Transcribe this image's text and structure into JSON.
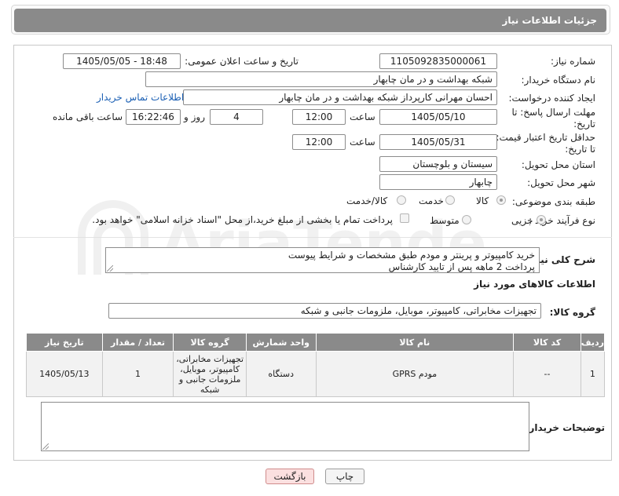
{
  "header": {
    "title": "جزئیات اطلاعات نیاز"
  },
  "form": {
    "need_number": {
      "label": "شماره نیاز:",
      "value": "1105092835000061"
    },
    "announce": {
      "label": "تاریخ و ساعت اعلان عمومی:",
      "value": "1405/05/05 - 18:48"
    },
    "buyer_org": {
      "label": "نام دستگاه خریدار:",
      "value": "شبکه بهداشت و در مان چابهار"
    },
    "requester": {
      "label": "ایجاد کننده درخواست:",
      "value": "احسان مهرانی کارپرداز شبکه بهداشت و در مان چابهار",
      "contact_link": "اطلاعات تماس خریدار"
    },
    "reply_deadline": {
      "label_line1": "مهلت ارسال پاسخ: تا",
      "label_line2": "تاریخ:",
      "date": "1405/05/10",
      "time_label": "ساعت",
      "time": "12:00",
      "days": "4",
      "days_label": "روز و",
      "remaining": "16:22:46",
      "remaining_label": "ساعت باقی مانده"
    },
    "price_validity": {
      "label_line1": "حداقل تاریخ اعتبار قیمت:",
      "label_line2": "تا تاریخ:",
      "date": "1405/05/31",
      "time_label": "ساعت",
      "time": "12:00"
    },
    "delivery_province": {
      "label": "استان محل تحویل:",
      "value": "سیستان و بلوچستان"
    },
    "delivery_city": {
      "label": "شهر محل تحویل:",
      "value": "چابهار"
    },
    "category": {
      "label": "طبقه بندی موضوعی:",
      "options": [
        "کالا",
        "خدمت",
        "کالا/خدمت"
      ],
      "selected": "کالا"
    },
    "purchase_type": {
      "label": "نوع فرآیند خرید :",
      "options": [
        "جزیی",
        "متوسط"
      ],
      "selected": "جزیی",
      "payment_note": "پرداخت تمام یا بخشی از مبلغ خرید،از محل \"اسناد خزانه اسلامی\" خواهد بود."
    },
    "description": {
      "label": "شرح کلی نیاز:",
      "line1": "خرید کامپیوتر و پرینتر و مودم طبق مشخصات و شرایط پیوست",
      "line2": "پرداخت 2 ماهه پس از تایید کارشناس"
    },
    "goods_info_title": "اطلاعات کالاهای مورد نیاز",
    "goods_group": {
      "label": "گروه کالا:",
      "value": "تجهیزات مخابراتی، کامپیوتر، موبایل، ملزومات جانبی و شبکه"
    },
    "buyer_notes": {
      "label": "توضیحات خریدار:",
      "value": ""
    }
  },
  "goods_table": {
    "headers": [
      "ردیف",
      "کد کالا",
      "نام کالا",
      "واحد شمارش",
      "گروه کالا",
      "تعداد / مقدار",
      "تاریخ نیاز"
    ],
    "rows": [
      {
        "row": "1",
        "code": "--",
        "name": "مودم GPRS",
        "unit": "دستگاه",
        "group": "تجهیزات مخابراتی، کامپیوتر، موبایل، ملزومات جانبی و شبکه",
        "qty": "1",
        "date": "1405/05/13"
      }
    ]
  },
  "buttons": {
    "print": "چاپ",
    "back": "بازگشت"
  },
  "watermark": {
    "text": "AriaTender.net"
  },
  "colors": {
    "header_bg": "#8a8a8a",
    "link": "#1a5fb4",
    "back_button_bg": "#fbe0e0"
  }
}
